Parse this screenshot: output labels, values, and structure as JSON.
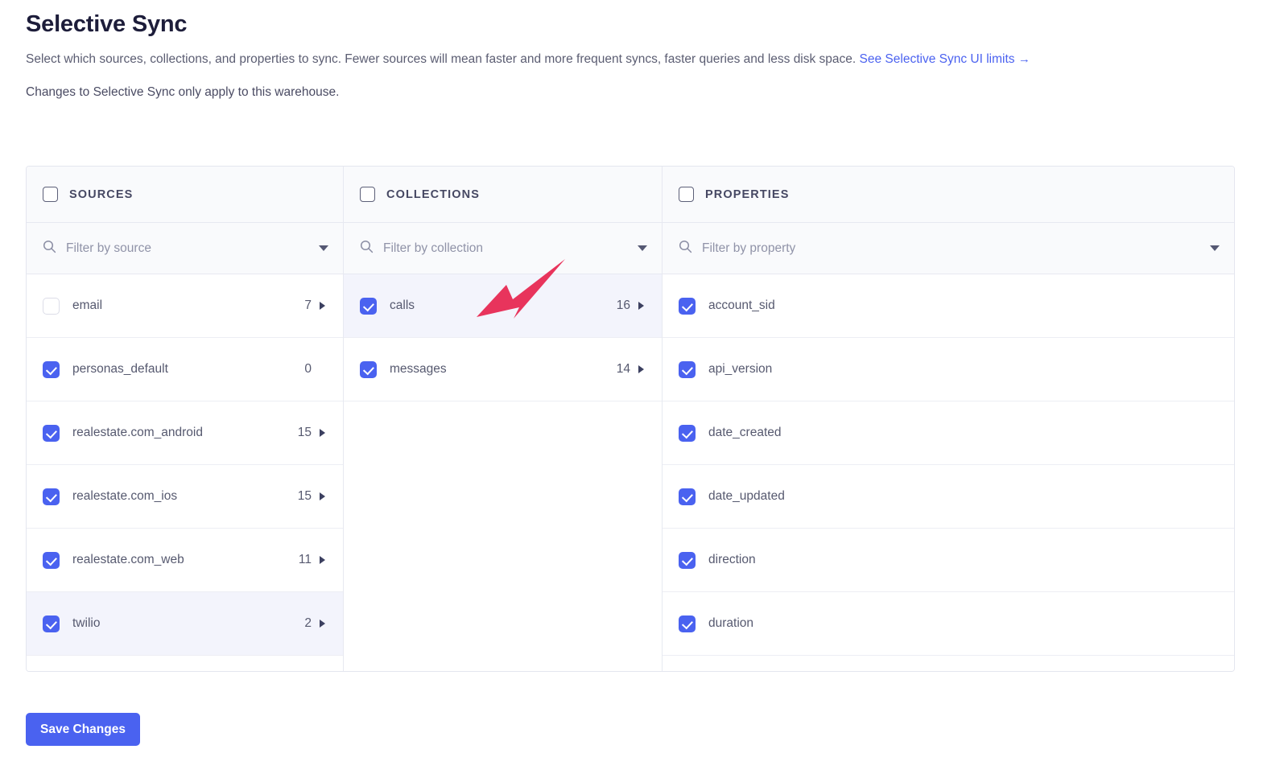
{
  "header": {
    "title": "Selective Sync",
    "description_before_link": "Select which sources, collections, and properties to sync. Fewer sources will mean faster and more frequent syncs, faster queries and less disk space. ",
    "link_text": "See Selective Sync UI limits",
    "link_arrow": "→",
    "description_line_2": "Changes to Selective Sync only apply to this warehouse."
  },
  "columns": {
    "sources": {
      "header_label": "SOURCES",
      "header_checkbox_checked": false,
      "filter_placeholder": "Filter by source",
      "filter_value": "",
      "rows": [
        {
          "label": "email",
          "count": "7",
          "checked": false,
          "selected": false,
          "has_caret": true
        },
        {
          "label": "personas_default",
          "count": "0",
          "checked": true,
          "selected": false,
          "has_caret": false
        },
        {
          "label": "realestate.com_android",
          "count": "15",
          "checked": true,
          "selected": false,
          "has_caret": true
        },
        {
          "label": "realestate.com_ios",
          "count": "15",
          "checked": true,
          "selected": false,
          "has_caret": true
        },
        {
          "label": "realestate.com_web",
          "count": "11",
          "checked": true,
          "selected": false,
          "has_caret": true
        },
        {
          "label": "twilio",
          "count": "2",
          "checked": true,
          "selected": true,
          "has_caret": true
        }
      ]
    },
    "collections": {
      "header_label": "COLLECTIONS",
      "header_checkbox_checked": false,
      "filter_placeholder": "Filter by collection",
      "filter_value": "",
      "rows": [
        {
          "label": "calls",
          "count": "16",
          "checked": true,
          "selected": true,
          "has_caret": true
        },
        {
          "label": "messages",
          "count": "14",
          "checked": true,
          "selected": false,
          "has_caret": true
        }
      ]
    },
    "properties": {
      "header_label": "PROPERTIES",
      "header_checkbox_checked": false,
      "filter_placeholder": "Filter by property",
      "filter_value": "",
      "rows": [
        {
          "label": "account_sid",
          "count": "",
          "checked": true,
          "selected": false,
          "has_caret": false
        },
        {
          "label": "api_version",
          "count": "",
          "checked": true,
          "selected": false,
          "has_caret": false
        },
        {
          "label": "date_created",
          "count": "",
          "checked": true,
          "selected": false,
          "has_caret": false
        },
        {
          "label": "date_updated",
          "count": "",
          "checked": true,
          "selected": false,
          "has_caret": false
        },
        {
          "label": "direction",
          "count": "",
          "checked": true,
          "selected": false,
          "has_caret": false
        },
        {
          "label": "duration",
          "count": "",
          "checked": true,
          "selected": false,
          "has_caret": false
        }
      ]
    }
  },
  "footer": {
    "save_label": "Save Changes"
  },
  "colors": {
    "accent_blue": "#4a62f0",
    "link_blue": "#4b62f0",
    "annotation_arrow": "#e8345c",
    "row_selected_bg": "#f3f4fc",
    "header_bg": "#f9fafc"
  }
}
